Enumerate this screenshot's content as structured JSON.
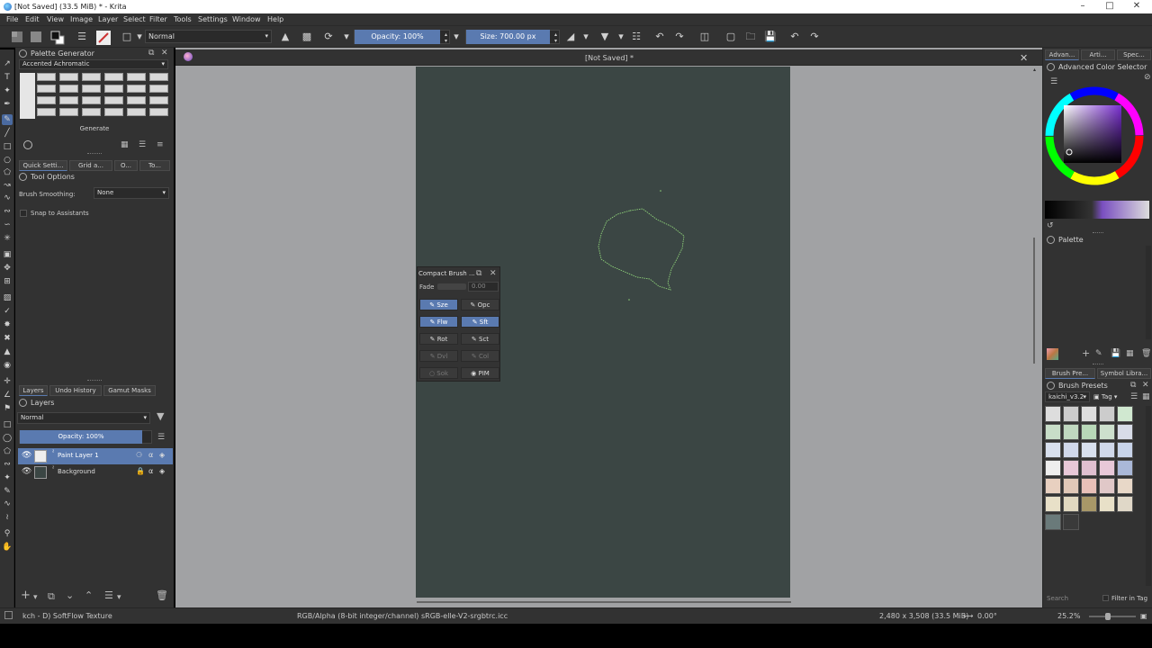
{
  "window": {
    "title": "[Not Saved] (33.5 MiB) * - Krita",
    "minimize_icon": "minimize-icon",
    "maximize_icon": "maximize-icon",
    "close_icon": "close-icon"
  },
  "menu": [
    "File",
    "Edit",
    "View",
    "Image",
    "Layer",
    "Select",
    "Filter",
    "Tools",
    "Settings",
    "Window",
    "Help"
  ],
  "toolbar": {
    "blend_mode": "Normal",
    "opacity_label": "Opacity: 100%",
    "opacity_value": 1.0,
    "size_label": "Size: 700.00 px"
  },
  "palette_generator": {
    "title": "Palette Generator",
    "palette_name": "Accented Achromatic",
    "generate_label": "Generate"
  },
  "left_tabs": [
    "Quick Setti...",
    "Grid a...",
    "O...",
    "To..."
  ],
  "tool_options": {
    "title": "Tool Options",
    "smoothing_label": "Brush Smoothing:",
    "smoothing_value": "None",
    "snap_label": "Snap to Assistants"
  },
  "layers_tabs": [
    "Layers",
    "Undo History",
    "Gamut Masks"
  ],
  "layers": {
    "title": "Layers",
    "blend_mode": "Normal",
    "opacity_label": "Opacity: 100%",
    "items": [
      {
        "name": "Paint Layer 1",
        "selected": true
      },
      {
        "name": "Background",
        "selected": false
      }
    ]
  },
  "document": {
    "tab_title": "[Not Saved] *"
  },
  "compact_brush": {
    "title": "Compact Brush ...",
    "fade_label": "Fade",
    "fade_value": "0.00",
    "buttons": [
      {
        "label": "Sze",
        "state": "on"
      },
      {
        "label": "Opc",
        "state": "off"
      },
      {
        "label": "Flw",
        "state": "on"
      },
      {
        "label": "Sft",
        "state": "on"
      },
      {
        "label": "Rot",
        "state": "off"
      },
      {
        "label": "Sct",
        "state": "off"
      },
      {
        "label": "Dvl",
        "state": "dis"
      },
      {
        "label": "Col",
        "state": "dis"
      },
      {
        "label": "Sok",
        "state": "dis"
      },
      {
        "label": "PIM",
        "state": "off"
      }
    ]
  },
  "right_tabs": [
    "Advan...",
    "Arti...",
    "Spec..."
  ],
  "color_selector": {
    "title": "Advanced Color Selector"
  },
  "palette": {
    "title": "Palette"
  },
  "right_tabs2": [
    "Brush Pre...",
    "Symbol Libra..."
  ],
  "brush_presets": {
    "title": "Brush Presets",
    "tag": "kaichi_v3.2",
    "tag_button": "Tag",
    "search_placeholder": "Search",
    "filter_label": "Filter in Tag"
  },
  "status": {
    "brush_name": "kch - D) SoftFlow Texture",
    "color_profile": "RGB/Alpha (8-bit integer/channel)  sRGB-elle-V2-srgbtrc.icc",
    "dimensions": "2,480 x 3,508 (33.5 MiB)",
    "rotation": "0.00°",
    "zoom": "25.2%"
  },
  "colors": {
    "canvas_bg": "#3b4644",
    "workspace_bg": "#a1a2a4",
    "panel_bg": "#323232",
    "accent": "#5a7ab0",
    "stroke": "#8fd27a"
  }
}
